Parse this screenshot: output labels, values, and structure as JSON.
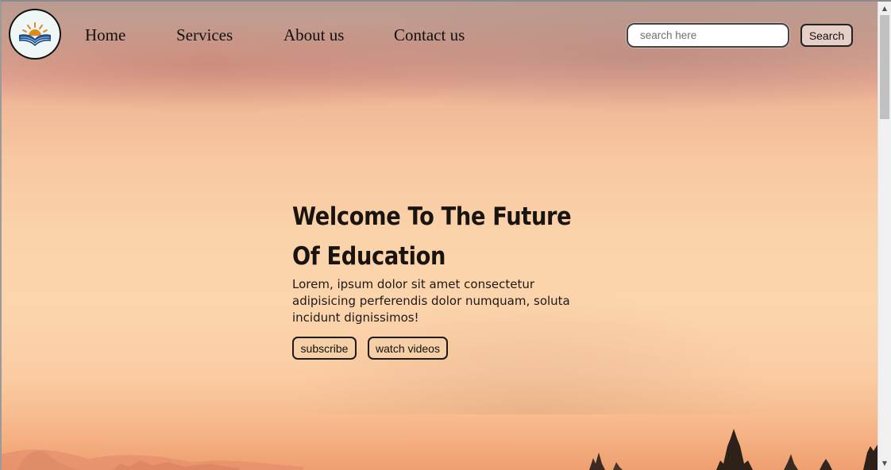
{
  "nav": {
    "logo_icon": "open-book-sunrise-icon",
    "links": [
      {
        "label": "Home"
      },
      {
        "label": "Services"
      },
      {
        "label": "About us"
      },
      {
        "label": "Contact us"
      }
    ]
  },
  "search": {
    "placeholder": "search here",
    "value": "",
    "button_label": "Search"
  },
  "hero": {
    "title": "Welcome To The Future Of Education",
    "description": "Lorem, ipsum dolor sit amet consectetur adipisicing perferendis dolor numquam, soluta incidunt dignissimos!",
    "subscribe_label": "subscribe",
    "watch_label": "watch videos"
  },
  "colors": {
    "sky_top": "#b99a90",
    "sky_middle": "#fcd5ad",
    "sky_bottom": "#ef9f70",
    "text": "#1a1411"
  }
}
